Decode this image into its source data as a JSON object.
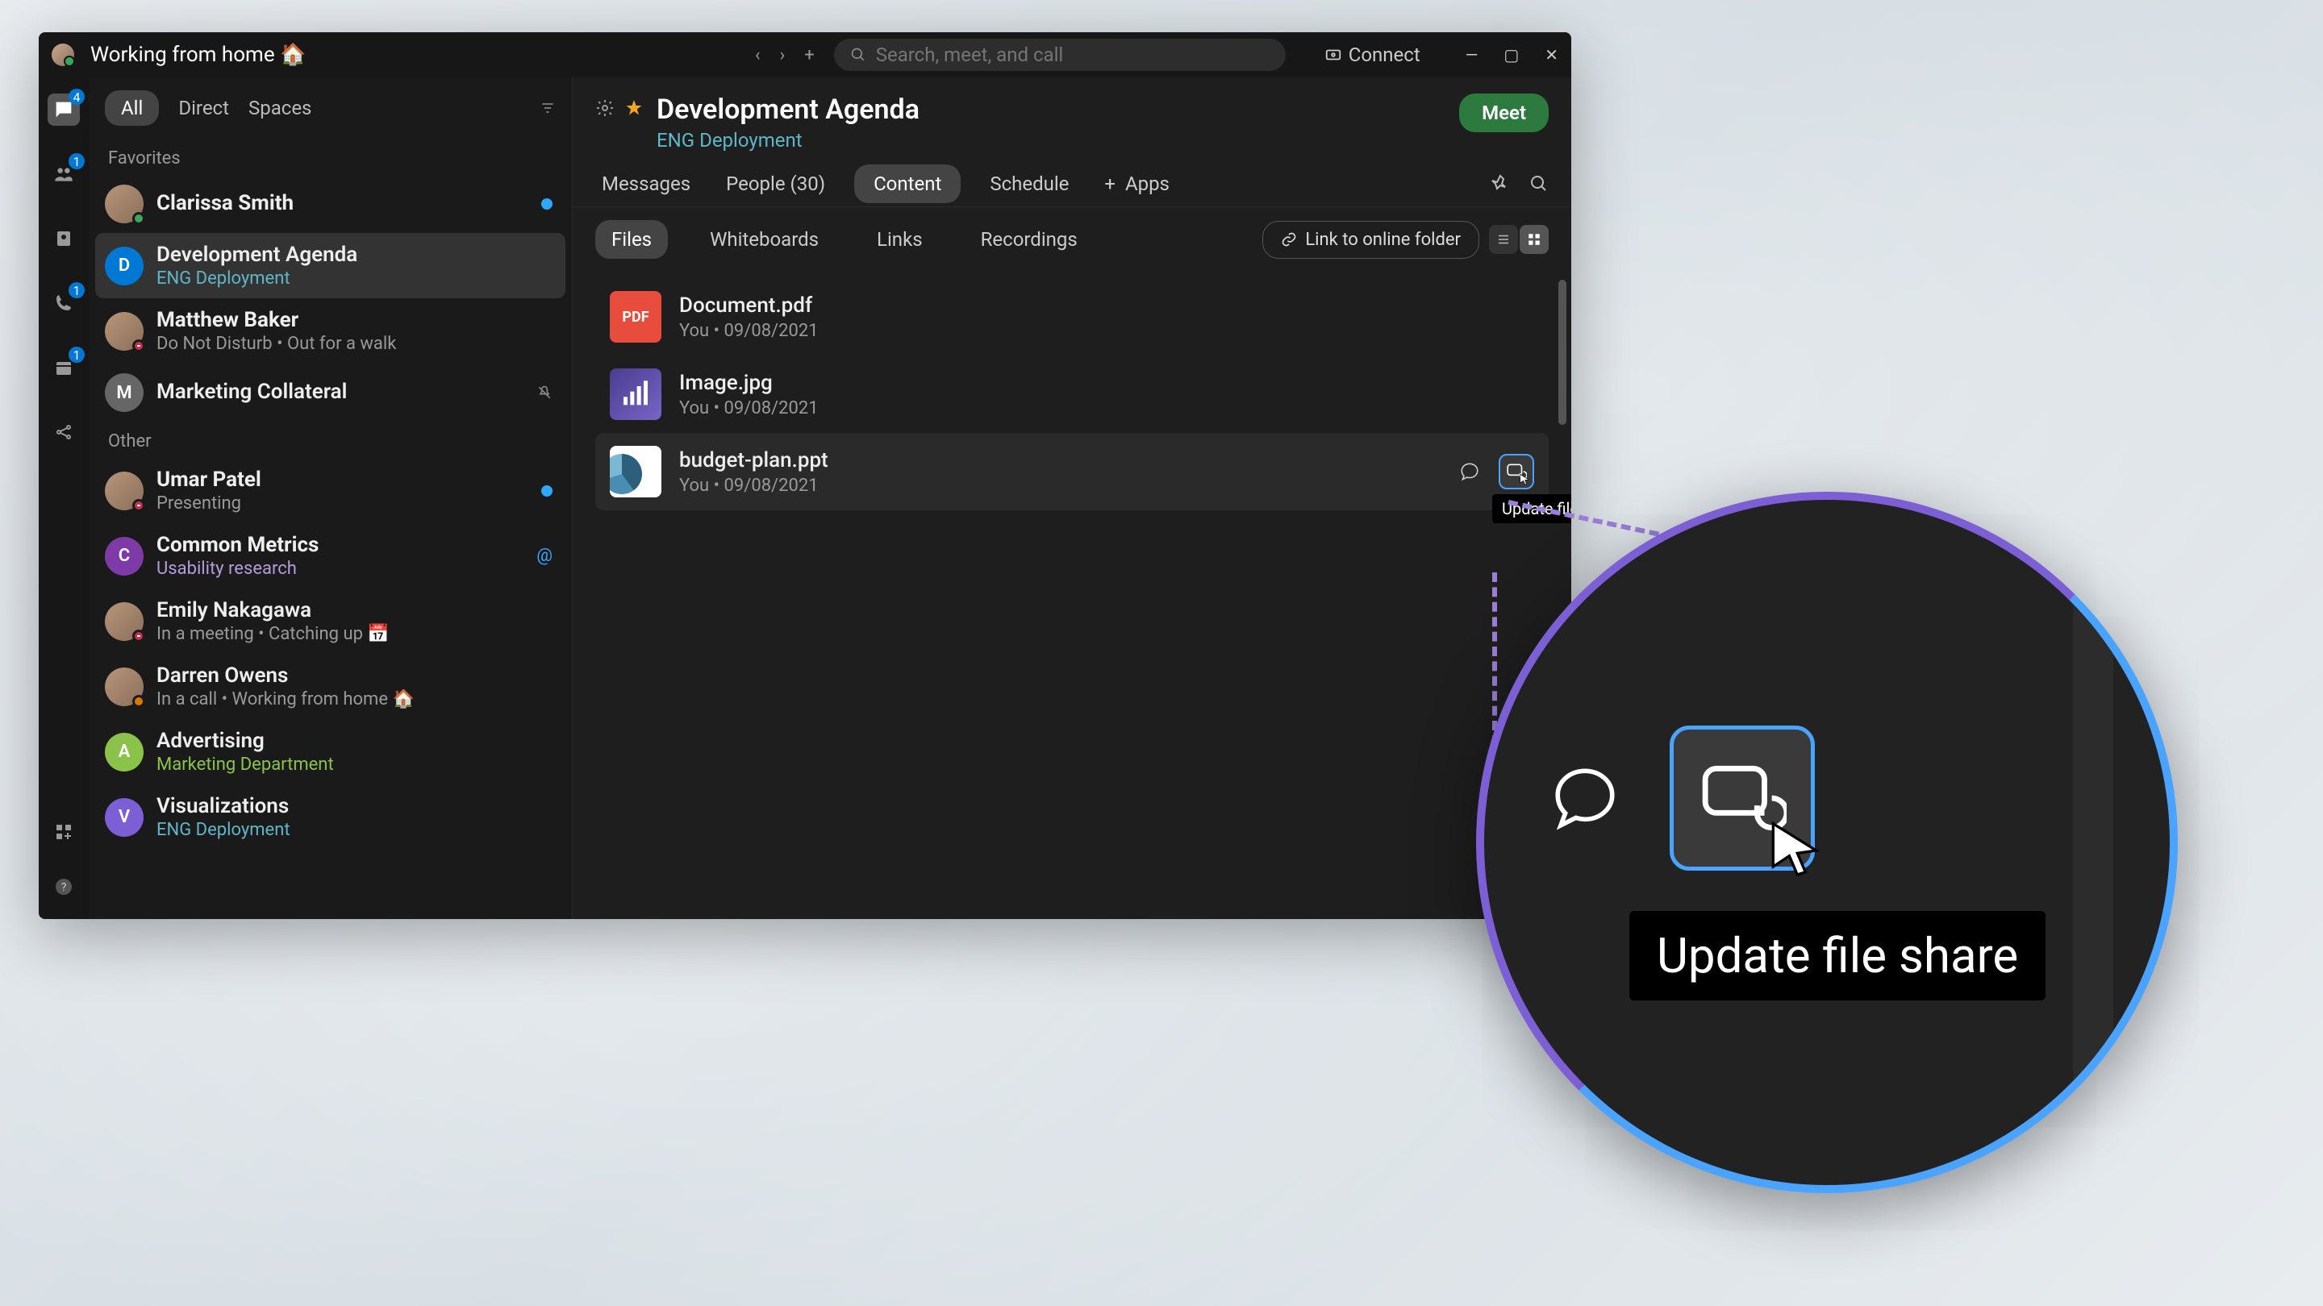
{
  "titlebar": {
    "status": "Working from home 🏠",
    "search_placeholder": "Search, meet, and call",
    "connect": "Connect"
  },
  "rail": {
    "badges": {
      "chat": "4",
      "teams": "1",
      "calls": "1",
      "calendar": "1"
    }
  },
  "filters": {
    "all": "All",
    "direct": "Direct",
    "spaces": "Spaces"
  },
  "sections": {
    "favorites": "Favorites",
    "other": "Other"
  },
  "conversations": {
    "favorites": [
      {
        "name": "Clarissa Smith",
        "sub": "",
        "avatar": "img",
        "presence": "green",
        "unread": true,
        "bold": true
      },
      {
        "name": "Development Agenda",
        "sub": "ENG Deployment",
        "avatar": "D",
        "avatarBg": "#0078d4",
        "subClass": "teal",
        "selected": true
      },
      {
        "name": "Matthew Baker",
        "sub": "Do Not Disturb  •  Out for a walk",
        "avatar": "img",
        "presence": "dnd",
        "bold": true
      },
      {
        "name": "Marketing Collateral",
        "sub": "",
        "avatar": "M",
        "avatarBg": "#666",
        "muted": true
      }
    ],
    "other": [
      {
        "name": "Umar Patel",
        "sub": "Presenting",
        "avatar": "img",
        "presence": "dnd",
        "bold": true,
        "unread": true
      },
      {
        "name": "Common Metrics",
        "sub": "Usability research",
        "avatar": "C",
        "avatarBg": "#7e3ba8",
        "subClass": "purple",
        "bold": true,
        "mention": true
      },
      {
        "name": "Emily Nakagawa",
        "sub": "In a meeting  •  Catching up 📅",
        "avatar": "img",
        "presence": "dnd"
      },
      {
        "name": "Darren Owens",
        "sub": "In a call  •  Working from home 🏠",
        "avatar": "img",
        "presence": "orange"
      },
      {
        "name": "Advertising",
        "sub": "Marketing Department",
        "avatar": "A",
        "avatarBg": "#8bc34a",
        "subClass": "green"
      },
      {
        "name": "Visualizations",
        "sub": "ENG Deployment",
        "avatar": "V",
        "avatarBg": "#7c5fd4",
        "subClass": "teal"
      }
    ]
  },
  "space": {
    "title": "Development Agenda",
    "subtitle": "ENG Deployment",
    "meet": "Meet"
  },
  "tabs": {
    "messages": "Messages",
    "people": "People (30)",
    "content": "Content",
    "schedule": "Schedule",
    "apps": "Apps"
  },
  "subtabs": {
    "files": "Files",
    "whiteboards": "Whiteboards",
    "links": "Links",
    "recordings": "Recordings",
    "link_folder": "Link to online folder"
  },
  "files": [
    {
      "name": "Document.pdf",
      "meta": "You   •   09/08/2021",
      "type": "pdf",
      "thumb_text": "PDF"
    },
    {
      "name": "Image.jpg",
      "meta": "You   •   09/08/2021",
      "type": "img"
    },
    {
      "name": "budget-plan.ppt",
      "meta": "You   •   09/08/2021",
      "type": "ppt",
      "hover": true
    }
  ],
  "tooltip": "Update file share",
  "magnify_tooltip": "Update file share"
}
